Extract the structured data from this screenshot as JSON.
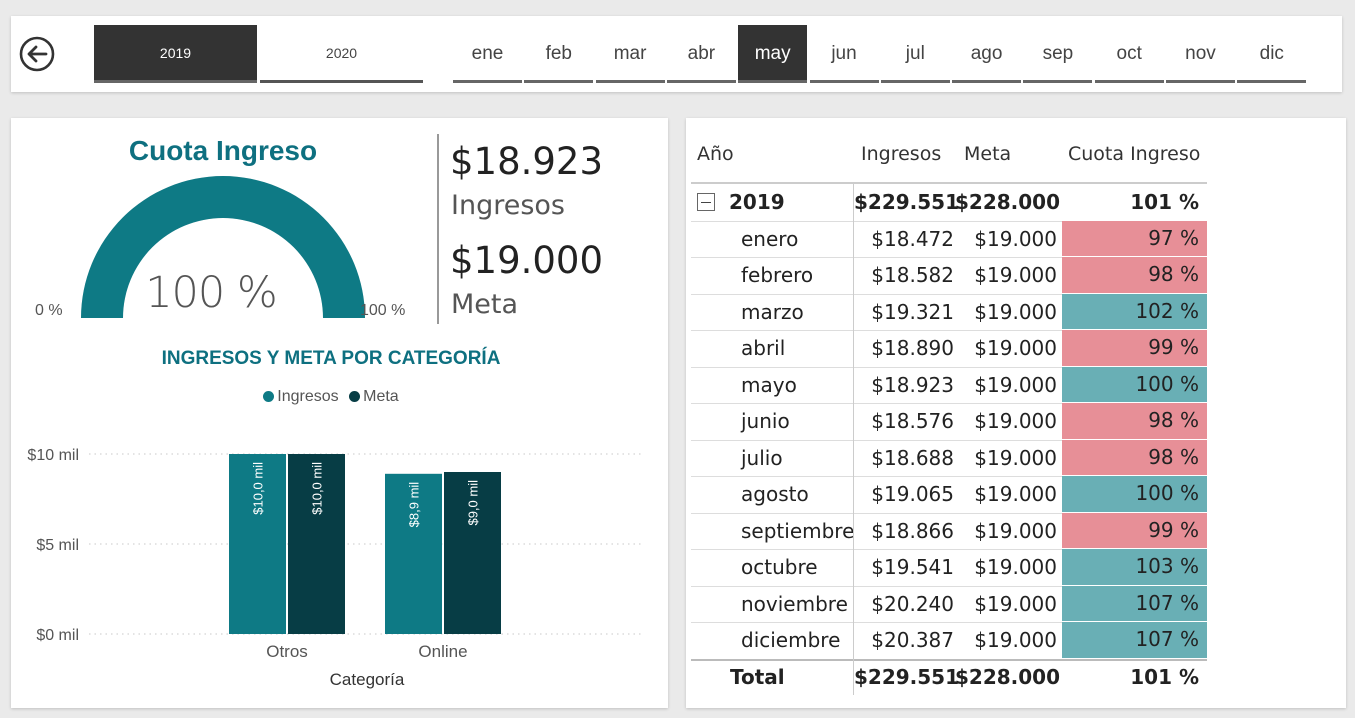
{
  "years": [
    {
      "label": "2019",
      "active": true
    },
    {
      "label": "2020",
      "active": false
    }
  ],
  "months": [
    {
      "label": "ene",
      "active": false
    },
    {
      "label": "feb",
      "active": false
    },
    {
      "label": "mar",
      "active": false
    },
    {
      "label": "abr",
      "active": false
    },
    {
      "label": "may",
      "active": true
    },
    {
      "label": "jun",
      "active": false
    },
    {
      "label": "jul",
      "active": false
    },
    {
      "label": "ago",
      "active": false
    },
    {
      "label": "sep",
      "active": false
    },
    {
      "label": "oct",
      "active": false
    },
    {
      "label": "nov",
      "active": false
    },
    {
      "label": "dic",
      "active": false
    }
  ],
  "gauge": {
    "title": "Cuota Ingreso",
    "value_text": "100 %",
    "value": 100,
    "min_label": "0 %",
    "max_label": "100 %",
    "color": "#0e7a85"
  },
  "kpi": {
    "ingresos_value": "$18.923",
    "ingresos_label": "Ingresos",
    "meta_value": "$19.000",
    "meta_label": "Meta"
  },
  "chart": {
    "title": "INGRESOS Y META POR CATEGORÍA",
    "legend": [
      {
        "name": "Ingresos",
        "color": "#0e7a85"
      },
      {
        "name": "Meta",
        "color": "#073d45"
      }
    ]
  },
  "chart_data": {
    "type": "bar",
    "categories": [
      "Otros",
      "Online"
    ],
    "series": [
      {
        "name": "Ingresos",
        "values": [
          10.0,
          8.9
        ],
        "labels": [
          "$10,0 mil",
          "$8,9 mil"
        ],
        "color": "#0e7a85"
      },
      {
        "name": "Meta",
        "values": [
          10.0,
          9.0
        ],
        "labels": [
          "$10,0 mil",
          "$9,0 mil"
        ],
        "color": "#073d45"
      }
    ],
    "xlabel": "Categoría",
    "ylabel": "",
    "ylim": [
      0,
      10
    ],
    "yticks": [
      {
        "value": 10,
        "label": "$10 mil"
      },
      {
        "value": 5,
        "label": "$5 mil"
      },
      {
        "value": 0,
        "label": "$0 mil"
      }
    ],
    "grid": true,
    "legend_position": "top-center"
  },
  "matrix": {
    "headers": [
      "Año",
      "Ingresos",
      "Meta",
      "Cuota Ingreso"
    ],
    "year_row": {
      "label": "2019",
      "ingresos": "$229.551",
      "meta": "$228.000",
      "cuota": "101 %"
    },
    "rows": [
      {
        "mes": "enero",
        "ingresos": "$18.472",
        "meta": "$19.000",
        "cuota": "97 %",
        "status": "below"
      },
      {
        "mes": "febrero",
        "ingresos": "$18.582",
        "meta": "$19.000",
        "cuota": "98 %",
        "status": "below"
      },
      {
        "mes": "marzo",
        "ingresos": "$19.321",
        "meta": "$19.000",
        "cuota": "102 %",
        "status": "above"
      },
      {
        "mes": "abril",
        "ingresos": "$18.890",
        "meta": "$19.000",
        "cuota": "99 %",
        "status": "below"
      },
      {
        "mes": "mayo",
        "ingresos": "$18.923",
        "meta": "$19.000",
        "cuota": "100 %",
        "status": "above"
      },
      {
        "mes": "junio",
        "ingresos": "$18.576",
        "meta": "$19.000",
        "cuota": "98 %",
        "status": "below"
      },
      {
        "mes": "julio",
        "ingresos": "$18.688",
        "meta": "$19.000",
        "cuota": "98 %",
        "status": "below"
      },
      {
        "mes": "agosto",
        "ingresos": "$19.065",
        "meta": "$19.000",
        "cuota": "100 %",
        "status": "above"
      },
      {
        "mes": "septiembre",
        "ingresos": "$18.866",
        "meta": "$19.000",
        "cuota": "99 %",
        "status": "below"
      },
      {
        "mes": "octubre",
        "ingresos": "$19.541",
        "meta": "$19.000",
        "cuota": "103 %",
        "status": "above"
      },
      {
        "mes": "noviembre",
        "ingresos": "$20.240",
        "meta": "$19.000",
        "cuota": "107 %",
        "status": "above"
      },
      {
        "mes": "diciembre",
        "ingresos": "$20.387",
        "meta": "$19.000",
        "cuota": "107 %",
        "status": "above"
      }
    ],
    "total_row": {
      "label": "Total",
      "ingresos": "$229.551",
      "meta": "$228.000",
      "cuota": "101 %"
    },
    "colors": {
      "below": "#e78f97",
      "above": "#69afb5"
    }
  }
}
